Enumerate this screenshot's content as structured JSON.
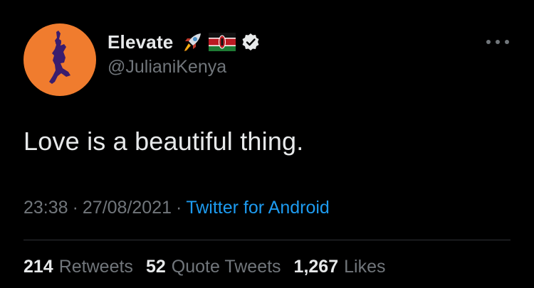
{
  "tweet": {
    "author": {
      "display_name": "Elevate",
      "handle": "@JulianiKenya",
      "badges": [
        "rocket-icon",
        "kenya-flag-icon",
        "verified-icon"
      ]
    },
    "text": "Love is a beautiful thing.",
    "time": "23:38",
    "separator": "·",
    "date": "27/08/2021",
    "source": "Twitter for Android",
    "stats": {
      "retweets_count": "214",
      "retweets_label": "Retweets",
      "quotes_count": "52",
      "quotes_label": "Quote Tweets",
      "likes_count": "1,267",
      "likes_label": "Likes"
    }
  },
  "colors": {
    "background": "#000000",
    "primary_text": "#e7e9ea",
    "secondary_text": "#71767b",
    "link": "#1d9bf0",
    "avatar_bg": "#f07c2e",
    "divider": "#2f3336"
  }
}
